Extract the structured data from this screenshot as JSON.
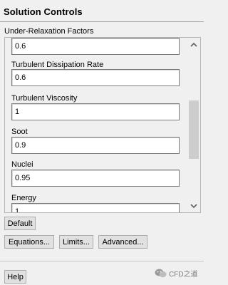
{
  "panel": {
    "title": "Solution Controls"
  },
  "group": {
    "label": "Under-Relaxation Factors"
  },
  "fields": [
    {
      "label": "",
      "value": "0.6"
    },
    {
      "label": "Turbulent Dissipation Rate",
      "value": "0.6"
    },
    {
      "label": "Turbulent Viscosity",
      "value": "1"
    },
    {
      "label": "Soot",
      "value": "0.9"
    },
    {
      "label": "Nuclei",
      "value": "0.95"
    },
    {
      "label": "Energy",
      "value": "1"
    }
  ],
  "buttons": {
    "default": "Default",
    "equations": "Equations...",
    "limits": "Limits...",
    "advanced": "Advanced...",
    "help": "Help"
  },
  "watermark": {
    "text": "CFD之道",
    "icon": "wechat-icon"
  },
  "colors": {
    "input_border": "#7a7a7a",
    "button_bg": "#e1e1e1",
    "panel_bg": "#f0f0f0"
  }
}
